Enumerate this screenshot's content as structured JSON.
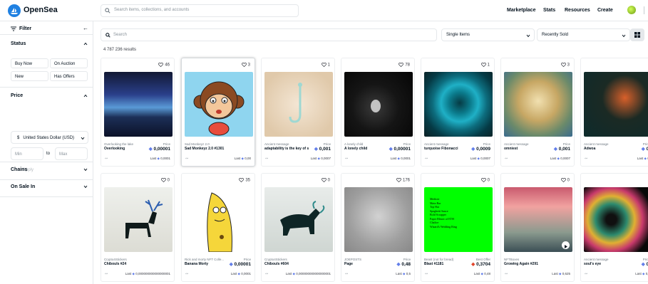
{
  "header": {
    "brand": "OpenSea",
    "search_placeholder": "Search items, collections, and accounts",
    "nav": [
      "Marketplace",
      "Stats",
      "Resources",
      "Create"
    ]
  },
  "sidebar": {
    "filter_label": "Filter",
    "collapse_icon": "←",
    "status_label": "Status",
    "status_options": [
      "Buy Now",
      "On Auction",
      "New",
      "Has Offers"
    ],
    "price_label": "Price",
    "currency_icon": "$",
    "currency": "United States Dollar (USD)",
    "min_placeholder": "Min",
    "to_label": "to",
    "max_placeholder": "Max",
    "apply_label": "Apply",
    "chains_label": "Chains",
    "onsale_label": "On Sale In"
  },
  "main": {
    "search_placeholder": "Search",
    "items_dropdown": "Single Items",
    "sort_dropdown": "Recently Sold",
    "results": "4 787 236 results"
  },
  "colors": {
    "eth": "#627eea",
    "accent": "#2081e2"
  },
  "cards": [
    {
      "collection": "Overlooking the lake",
      "name": "Overlooking",
      "price": "0,00001",
      "last": "0,0001",
      "favs": "46",
      "price_label": "Price"
    },
    {
      "collection": "Sad Monkeyz 2.0",
      "name": "Sad Monkeyz 2.0 #1301",
      "price": "",
      "last": "0,00",
      "favs": "3",
      "price_label": ""
    },
    {
      "collection": "Ancient message",
      "name": "adaptability is the key of su...",
      "price": "0,001",
      "last": "0,0007",
      "favs": "1",
      "price_label": "Price"
    },
    {
      "collection": "A lonely child",
      "name": "A lonely child",
      "price": "0,00001",
      "last": "0,0001",
      "favs": "78",
      "price_label": "Price"
    },
    {
      "collection": "Ancient message",
      "name": "turquoise Fibonacci",
      "price": "0,0009",
      "last": "0,0007",
      "favs": "1",
      "price_label": "Price"
    },
    {
      "collection": "Ancient message",
      "name": "omniest",
      "price": "0,001",
      "last": "0,0007",
      "favs": "3",
      "price_label": "Price"
    },
    {
      "collection": "Ancient message",
      "name": "Adwoa",
      "price": "0,",
      "last": "0,",
      "favs": "",
      "price_label": "Price"
    },
    {
      "collection": "Crypto4Stickers",
      "name": "Chibouls #24",
      "price": "",
      "last": "0,000000000000000001",
      "favs": "0",
      "price_label": ""
    },
    {
      "collection": "Rick and morty NFT Colle...",
      "name": "Banana Morty",
      "price": "0,00001",
      "last": "0,0001",
      "favs": "35",
      "price_label": "Price"
    },
    {
      "collection": "Crypto4Stickers",
      "name": "Chibouls #604",
      "price": "",
      "last": "0,000000000000000001",
      "favs": "0",
      "price_label": ""
    },
    {
      "collection": "JOEPOSTS",
      "name": "Page",
      "price": "0,48",
      "last": "0,5",
      "favs": "176",
      "price_label": "Price"
    },
    {
      "collection": "Beast (not for bread)",
      "name": "Blast #1181",
      "price": "0,3704",
      "last": "0,48",
      "favs": "0",
      "price_label": "Best Offer"
    },
    {
      "collection": "NFTBoxes",
      "name": "Growing Again #291",
      "price": "",
      "last": "0,625",
      "favs": "0",
      "price_label": ""
    },
    {
      "collection": "Ancient message",
      "name": "soul's eye",
      "price": "0,",
      "last": "0,0",
      "favs": "",
      "price_label": "Price"
    }
  ],
  "blast_lines": [
    "Medicer",
    "Main Bar",
    "Top Hat",
    "Spaghetti Sauce",
    "Bold Scrapper",
    "Paper Blister of ETH",
    "Chalice",
    "Wizard's Wedding Ring"
  ]
}
